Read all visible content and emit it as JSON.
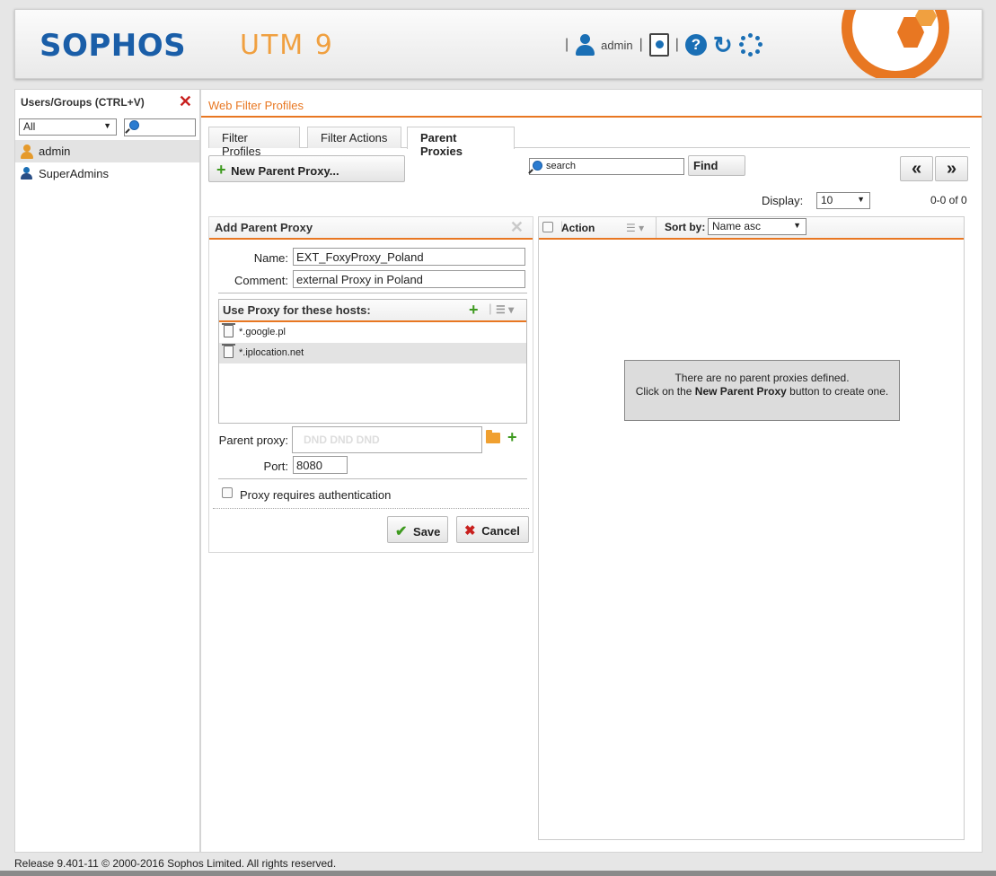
{
  "header": {
    "logo": "SOPHOS",
    "product": "UTM 9",
    "user": "admin"
  },
  "left": {
    "title": "Users/Groups (CTRL+V)",
    "filter_value": "All",
    "items": [
      {
        "label": "admin",
        "icon": "user-icon"
      },
      {
        "label": "SuperAdmins",
        "icon": "group-icon"
      }
    ]
  },
  "main": {
    "breadcrumb": "Web Filter Profiles",
    "tabs": [
      {
        "label": "Filter Profiles"
      },
      {
        "label": "Filter Actions"
      },
      {
        "label": "Parent Proxies",
        "active": true
      }
    ],
    "new_button": "New Parent Proxy...",
    "search_placeholder": "search",
    "find_button": "Find",
    "prev_label": "«",
    "next_label": "»",
    "display_label": "Display:",
    "display_value": "10",
    "count_label": "0-0 of 0"
  },
  "form": {
    "title": "Add Parent Proxy",
    "name_label": "Name:",
    "name_value": "EXT_FoxyProxy_Poland",
    "comment_label": "Comment:",
    "comment_value": "external Proxy in Poland",
    "hosts_title": "Use Proxy for these hosts:",
    "hosts": [
      "*.google.pl",
      "*.iplocation.net"
    ],
    "parent_proxy_label": "Parent proxy:",
    "dnd_text": "DND          DND          DND",
    "port_label": "Port:",
    "port_value": "8080",
    "auth_label": "Proxy requires authentication",
    "save_label": "Save",
    "cancel_label": "Cancel"
  },
  "list": {
    "action_label": "Action",
    "sortby_label": "Sort by:",
    "sort_value": "Name asc",
    "empty_line1": "There are no parent proxies defined.",
    "empty_line2_pre": "Click on the ",
    "empty_line2_bold": "New Parent Proxy",
    "empty_line2_post": " button to create one."
  },
  "footer": "Release 9.401-11  © 2000-2016 Sophos Limited. All rights reserved.",
  "colors": {
    "accent": "#e87722",
    "brand": "#1a5ea8"
  }
}
